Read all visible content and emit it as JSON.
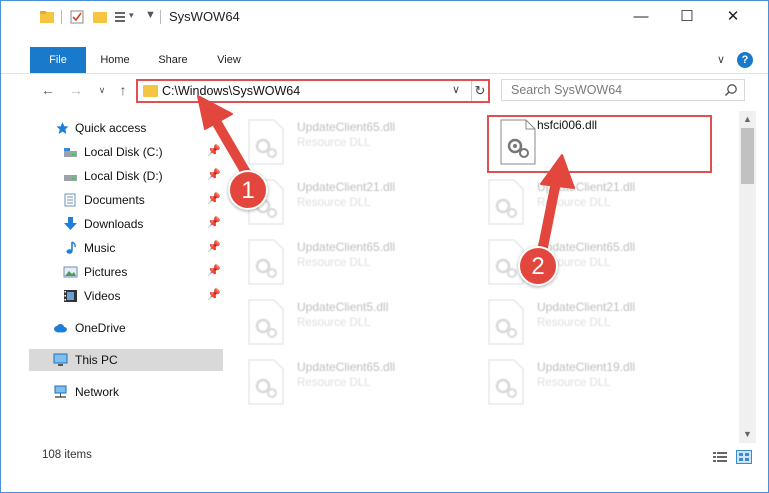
{
  "window": {
    "title": "SysWOW64",
    "controls": {
      "minimize": "—",
      "maximize": "☐",
      "close": "✕"
    }
  },
  "ribbon": {
    "tabs": [
      "File",
      "Home",
      "Share",
      "View"
    ],
    "help": "?",
    "collapse": "∨"
  },
  "address_bar": {
    "path": "C:\\Windows\\SysWOW64",
    "dropdown": "∨",
    "refresh": "↻"
  },
  "search": {
    "placeholder": "Search SysWOW64"
  },
  "nav": {
    "back": "←",
    "forward": "→",
    "recent": "∨",
    "up": "↑"
  },
  "sidebar": {
    "items": [
      {
        "label": "Quick access",
        "icon": "star-icon",
        "pinned": false
      },
      {
        "label": "Local Disk (C:)",
        "icon": "drive-icon",
        "pinned": true
      },
      {
        "label": "Local Disk (D:)",
        "icon": "drive-icon",
        "pinned": true
      },
      {
        "label": "Documents",
        "icon": "documents-icon",
        "pinned": true
      },
      {
        "label": "Downloads",
        "icon": "downloads-icon",
        "pinned": true
      },
      {
        "label": "Music",
        "icon": "music-icon",
        "pinned": true
      },
      {
        "label": "Pictures",
        "icon": "pictures-icon",
        "pinned": true
      },
      {
        "label": "Videos",
        "icon": "videos-icon",
        "pinned": true
      },
      {
        "label": "OneDrive",
        "icon": "cloud-icon",
        "pinned": false
      },
      {
        "label": "This PC",
        "icon": "computer-icon",
        "pinned": false,
        "selected": true
      },
      {
        "label": "Network",
        "icon": "network-icon",
        "pinned": false
      }
    ],
    "pin_glyph": "📌"
  },
  "files": {
    "left_column": [
      {
        "name": "UpdateClient65.dll",
        "type": "Resource DLL"
      },
      {
        "name": "UpdateClient21.dll",
        "type": "Resource DLL"
      },
      {
        "name": "UpdateClient65.dll",
        "type": "Resource DLL"
      },
      {
        "name": "UpdateClient5.dll",
        "type": "Resource DLL"
      },
      {
        "name": "UpdateClient65.dll",
        "type": "Resource DLL"
      }
    ],
    "right_column": [
      {
        "name": "hsfci006.dll",
        "type": ""
      },
      {
        "name": "UpdateClient21.dll",
        "type": "Resource DLL"
      },
      {
        "name": "UpdateClient65.dll",
        "type": "Resource DLL"
      },
      {
        "name": "UpdateClient21.dll",
        "type": "Resource DLL"
      },
      {
        "name": "UpdateClient19.dll",
        "type": "Resource DLL"
      }
    ]
  },
  "status_bar": {
    "item_count": "108 items"
  },
  "annotations": {
    "badge_1": "1",
    "badge_2": "2",
    "color": "#e2463c"
  },
  "colors": {
    "accent": "#1979ca",
    "highlight": "#e05050",
    "folder": "#f5c542"
  }
}
